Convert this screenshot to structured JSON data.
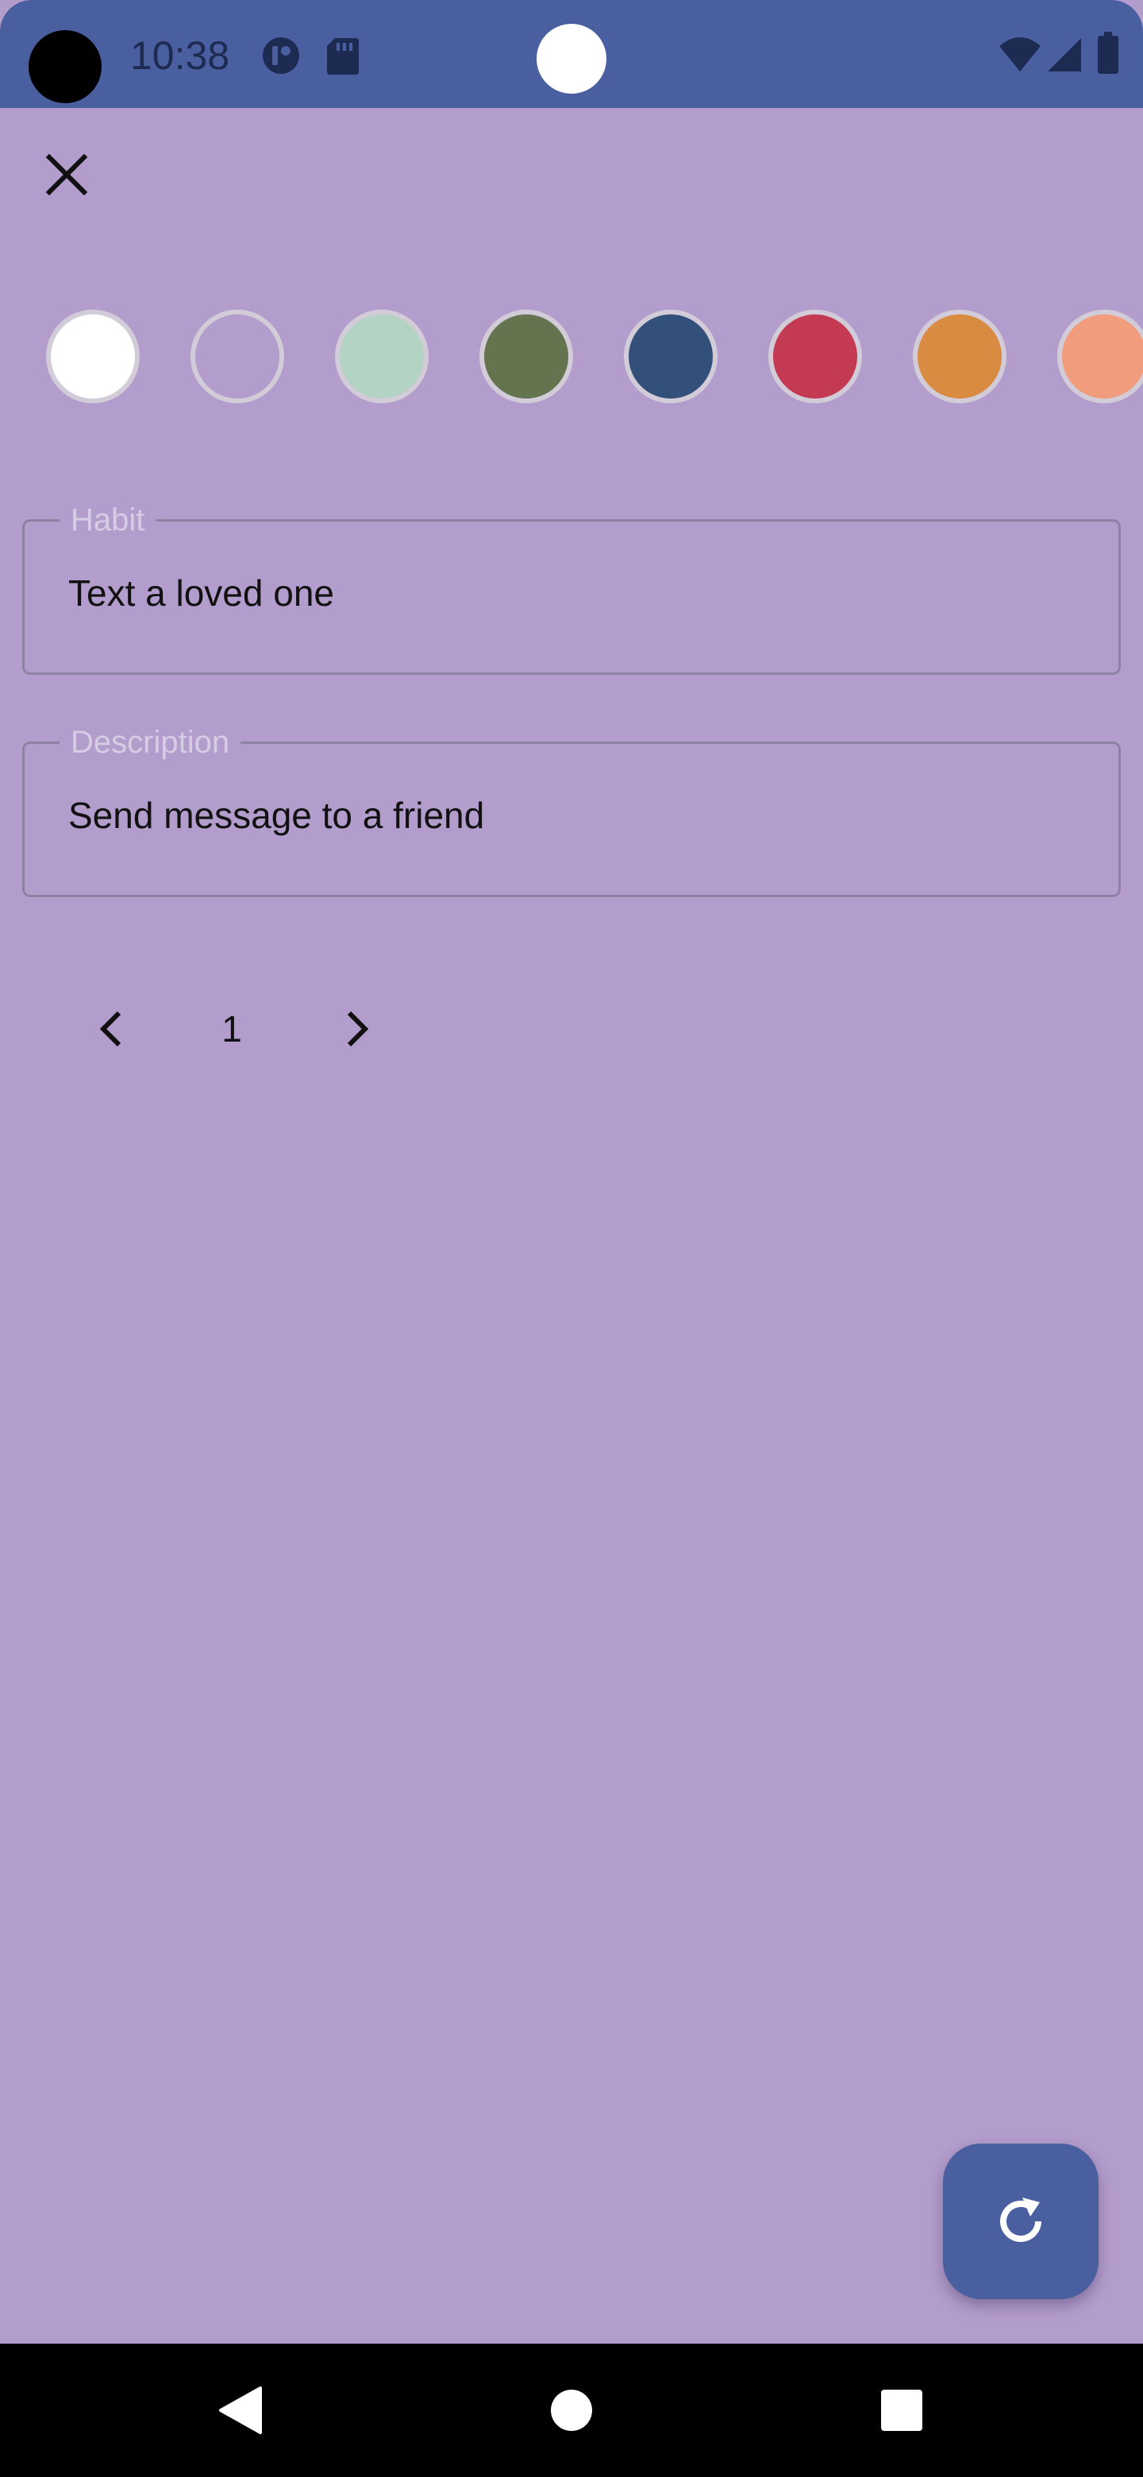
{
  "status_bar": {
    "time": "10:38",
    "icons": [
      "camera-hole",
      "app-notification-icon",
      "sd-card-icon",
      "wifi-icon",
      "signal-icon",
      "battery-icon"
    ]
  },
  "toolbar": {
    "close_icon": "close-icon"
  },
  "colors": {
    "accent": "#4a5fa0",
    "background": "#b39dcc",
    "swatches": [
      "#ffffff",
      "#b39dcc",
      "#b3d3c4",
      "#63744f",
      "#33507a",
      "#c43a52",
      "#d98b41",
      "#f19c7c"
    ]
  },
  "form": {
    "habit_label": "Habit",
    "habit_value": "Text a loved one",
    "description_label": "Description",
    "description_value": "Send message to a friend"
  },
  "pager": {
    "current": "1",
    "prev_icon": "chevron-left-icon",
    "next_icon": "chevron-right-icon"
  },
  "fab": {
    "icon": "refresh-icon"
  },
  "nav_bar": {
    "icons": [
      "back-icon",
      "home-icon",
      "recents-icon"
    ]
  }
}
